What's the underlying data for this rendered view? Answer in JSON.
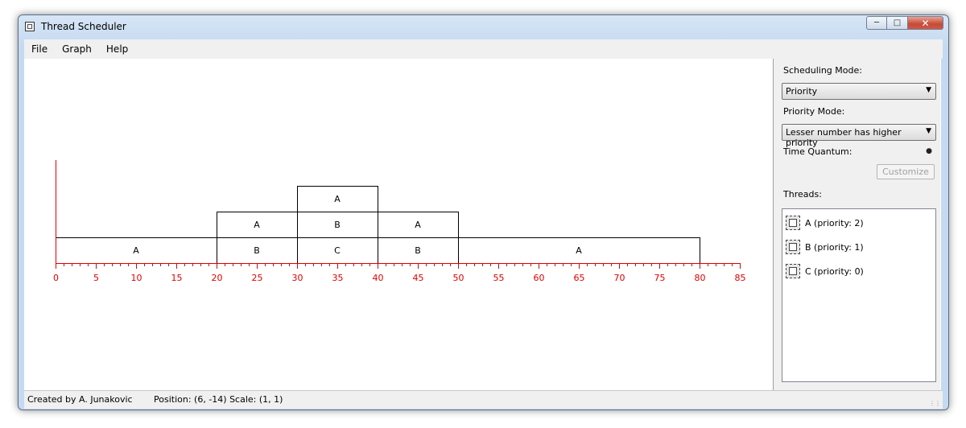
{
  "window": {
    "title": "Thread Scheduler"
  },
  "menu": [
    "File",
    "Graph",
    "Help"
  ],
  "panel": {
    "scheduling_mode_label": "Scheduling Mode:",
    "scheduling_mode_value": "Priority",
    "priority_mode_label": "Priority Mode:",
    "priority_mode_value": "Lesser number has higher priority",
    "time_quantum_label": "Time Quantum:",
    "customize_label": "Customize",
    "threads_label": "Threads:",
    "threads": [
      {
        "label": "A (priority: 2)"
      },
      {
        "label": "B (priority: 1)"
      },
      {
        "label": "C (priority: 0)"
      }
    ]
  },
  "status": {
    "created_by": "Created by A. Junakovic",
    "position_scale": "Position: (6, -14)  Scale: (1, 1)"
  },
  "colors": {
    "axis": "#e00000",
    "block_border": "#000000"
  },
  "chart_data": {
    "type": "gantt",
    "x_ticks": [
      0,
      5,
      10,
      15,
      20,
      25,
      30,
      35,
      40,
      45,
      50,
      55,
      60,
      65,
      70,
      75,
      80,
      85
    ],
    "xlim": [
      0,
      85
    ],
    "blocks": [
      {
        "label": "A",
        "start": 0,
        "end": 20,
        "level": 0
      },
      {
        "label": "B",
        "start": 20,
        "end": 30,
        "level": 0
      },
      {
        "label": "C",
        "start": 30,
        "end": 40,
        "level": 0
      },
      {
        "label": "B",
        "start": 40,
        "end": 50,
        "level": 0
      },
      {
        "label": "A",
        "start": 50,
        "end": 80,
        "level": 0
      },
      {
        "label": "A",
        "start": 20,
        "end": 30,
        "level": 1
      },
      {
        "label": "B",
        "start": 30,
        "end": 40,
        "level": 1
      },
      {
        "label": "A",
        "start": 40,
        "end": 50,
        "level": 1
      },
      {
        "label": "A",
        "start": 30,
        "end": 40,
        "level": 2
      }
    ]
  }
}
